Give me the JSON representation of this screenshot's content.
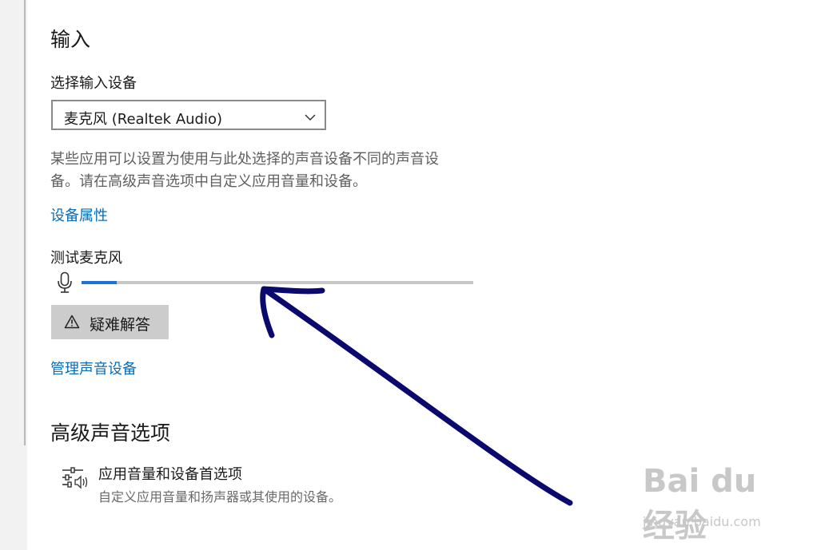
{
  "input_section": {
    "title": "输入",
    "select_label": "选择输入设备",
    "selected_device": "麦克风 (Realtek Audio)",
    "description_lines": [
      "某些应用可以设置为使用与此处选择的声音设备不同的声音设",
      "备。请在高级声音选项中自定义应用音量和设备。"
    ],
    "device_properties_link": "设备属性",
    "test_label": "测试麦克风",
    "mic_level": 0.09,
    "troubleshoot_label": "疑难解答",
    "manage_link": "管理声音设备"
  },
  "advanced_section": {
    "title": "高级声音选项",
    "item_title": "应用音量和设备首选项",
    "item_subtitle": "自定义应用音量和扬声器或其使用的设备。"
  },
  "icons": {
    "dropdown": "chevron-down-icon",
    "mic": "microphone-icon",
    "troubleshoot": "warning-icon",
    "advanced": "sliders-icon"
  },
  "colors": {
    "link": "#0a6cb5",
    "meter_fill": "#1a73d6",
    "annotation_arrow": "#0a0a6e"
  },
  "watermark": {
    "main": "Bai du 经验",
    "sub": "jingyan.baidu.com"
  }
}
